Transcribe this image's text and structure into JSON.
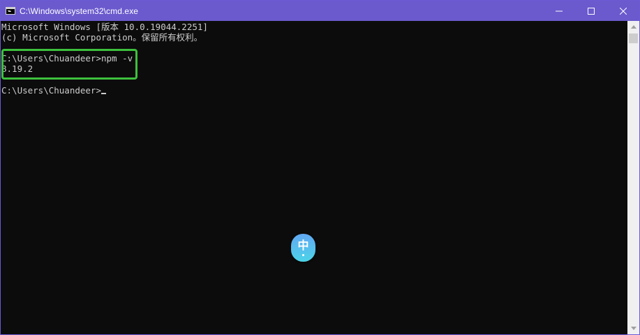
{
  "window": {
    "title": "C:\\Windows\\system32\\cmd.exe",
    "title_icon": "cmd-console-icon",
    "title_bar_color": "#6a5acd"
  },
  "controls": {
    "minimize_icon": "minimize-icon",
    "maximize_icon": "maximize-icon",
    "close_icon": "close-icon"
  },
  "console": {
    "background": "#0c0c0c",
    "foreground": "#cccccc",
    "lines": [
      "Microsoft Windows [版本 10.0.19044.2251]",
      "(c) Microsoft Corporation。保留所有权利。",
      "",
      "C:\\Users\\Chuandeer>npm -v",
      "8.19.2",
      "",
      "C:\\Users\\Chuandeer>"
    ]
  },
  "highlight": {
    "color": "#3cc13c"
  },
  "ime": {
    "char": "中",
    "icon": "ime-indicator-icon"
  },
  "scrollbar": {
    "up_icon": "scroll-up-arrow-icon",
    "down_icon": "scroll-down-arrow-icon"
  }
}
